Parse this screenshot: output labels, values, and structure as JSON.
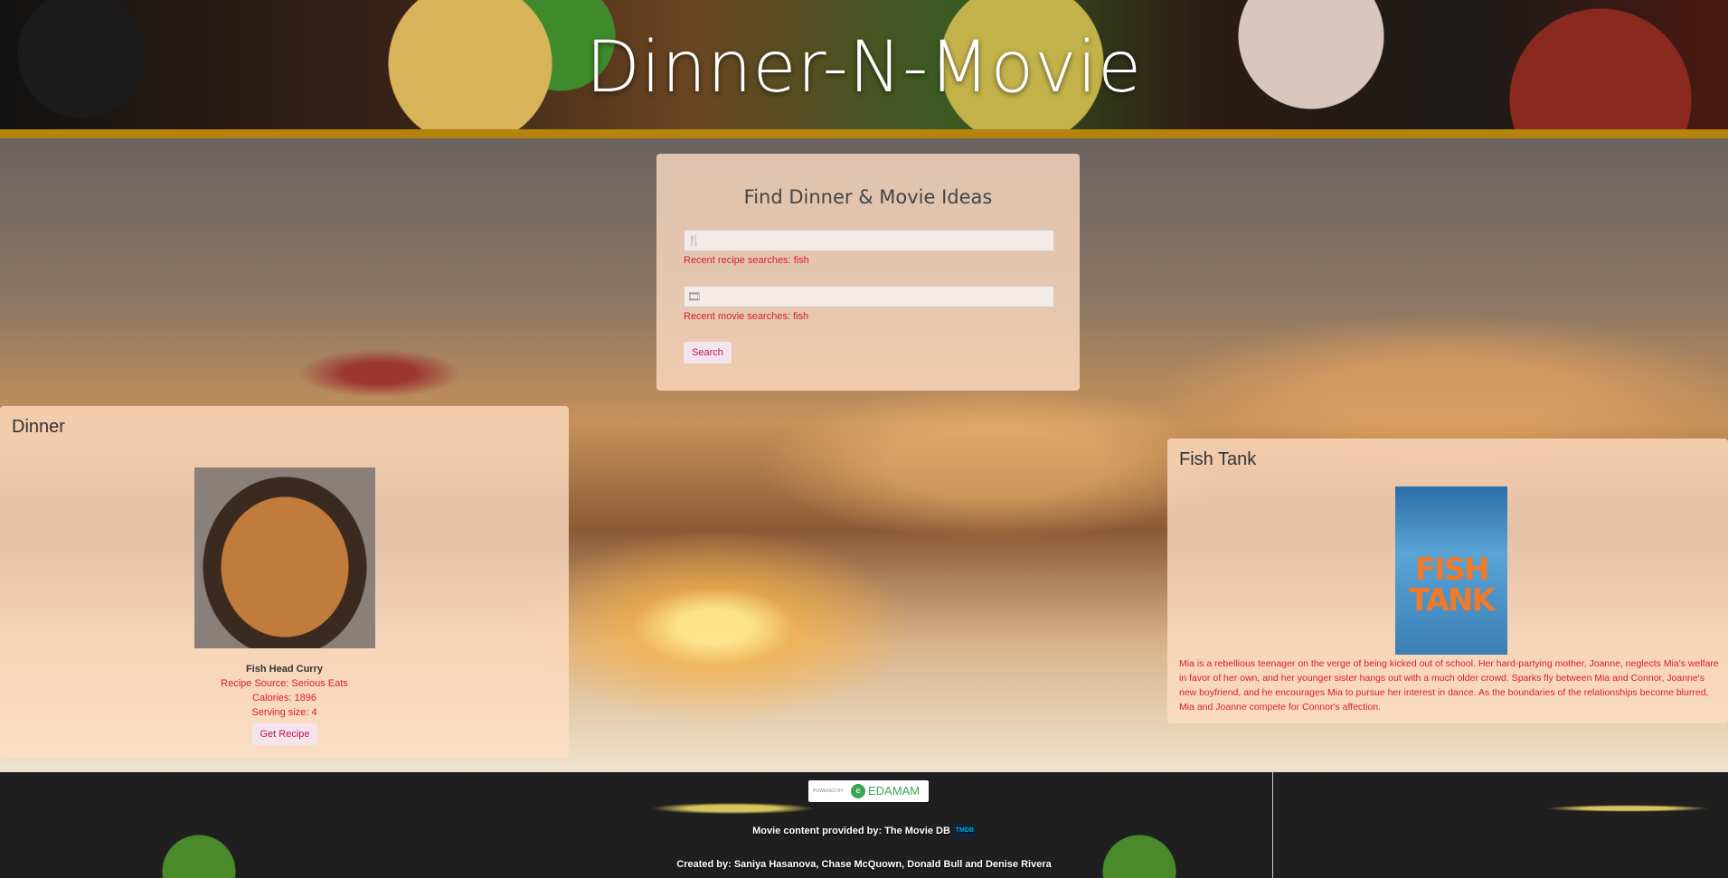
{
  "header": {
    "title": "Dinner-N-Movie"
  },
  "search": {
    "title": "Find Dinner & Movie Ideas",
    "recipe_placeholder": "",
    "recipe_icon": "fork-knife-icon",
    "recent_recipe": "Recent recipe searches: fish",
    "movie_placeholder": "",
    "movie_icon": "film-icon",
    "recent_movie": "Recent movie searches: fish",
    "button_label": "Search"
  },
  "dinner": {
    "heading": "Dinner",
    "name": "Fish Head Curry",
    "source": "Recipe Source: Serious Eats",
    "calories": "Calories: 1896",
    "serving": "Serving size: 4",
    "button_label": "Get Recipe"
  },
  "movie": {
    "title": "Fish Tank",
    "poster_title": "FISH TANK",
    "overview": "Mia is a rebellious teenager on the verge of being kicked out of school. Her hard-partying mother, Joanne, neglects Mia's welfare in favor of her own, and her younger sister hangs out with a much older crowd. Sparks fly between Mia and Connor, Joanne's new boyfriend, and he encourages Mia to pursue her interest in dance. As the boundaries of the relationships become blurred, Mia and Joanne compete for Connor's affection."
  },
  "footer": {
    "edamam_small": "POWERED BY",
    "edamam_name": "EDAMAM",
    "tmdb_credit": "Movie content provided by: The Movie DB",
    "tmdb_badge": "TMDB",
    "created_by": "Created by: Saniya Hasanova, Chase McQuown, Donald Bull and Denise Rivera"
  },
  "colors": {
    "accent_red": "#d81b3a",
    "header_bar": "#b6840d",
    "card_bg": "#ffdec4"
  }
}
